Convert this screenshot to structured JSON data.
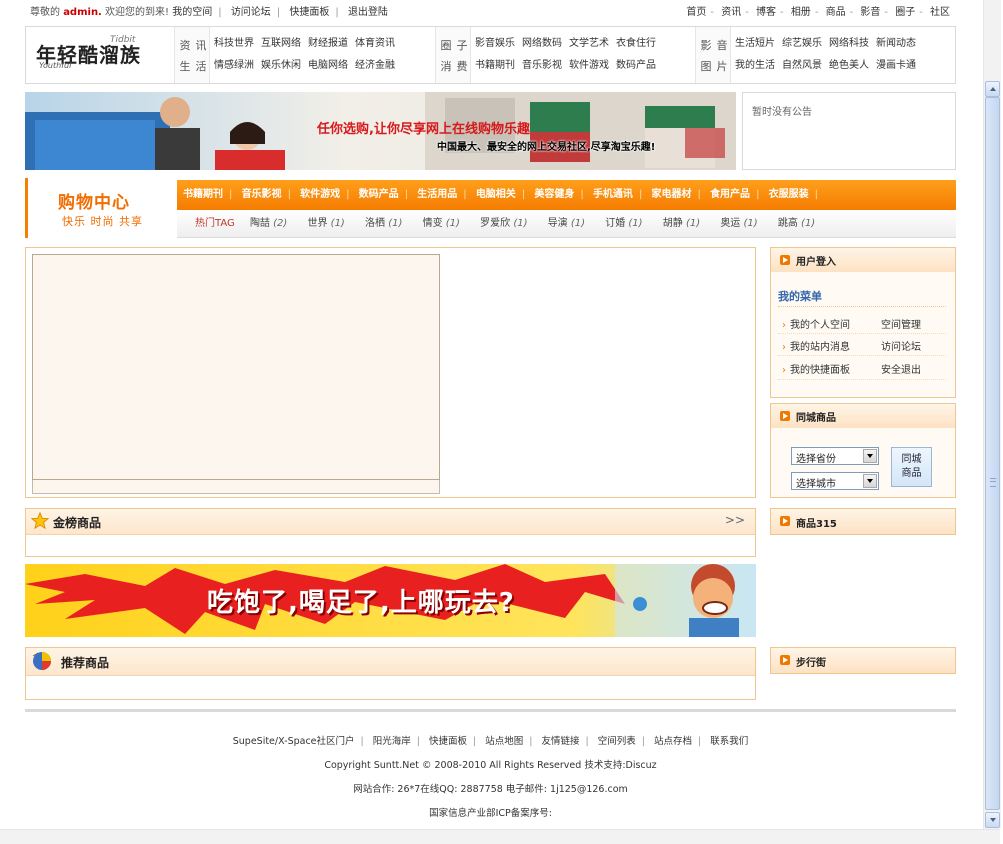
{
  "topbar": {
    "welcome_prefix": "尊敬的",
    "username": "admin.",
    "welcome_suffix": "欢迎您的到来!",
    "links": [
      "我的空间",
      "访问论坛",
      "快捷面板",
      "退出登陆"
    ],
    "right_links": [
      "首页",
      "资讯",
      "博客",
      "相册",
      "商品",
      "影音",
      "圈子",
      "社区"
    ]
  },
  "logo": {
    "cn": "年轻酷溜族",
    "en1": "Youthful",
    "en2": "Tidbit"
  },
  "nav": [
    {
      "cat": [
        "资",
        "讯",
        "生",
        "活"
      ],
      "rows": [
        [
          "科技世界",
          "互联网络",
          "财经报道",
          "体育资讯"
        ],
        [
          "情感绿洲",
          "娱乐休闲",
          "电脑网络",
          "经济金融"
        ]
      ]
    },
    {
      "cat": [
        "圈",
        "子",
        "消",
        "费"
      ],
      "rows": [
        [
          "影音娱乐",
          "网络数码",
          "文学艺术",
          "衣食住行"
        ],
        [
          "书籍期刊",
          "音乐影视",
          "软件游戏",
          "数码产品"
        ]
      ]
    },
    {
      "cat": [
        "影",
        "音",
        "图",
        "片"
      ],
      "rows": [
        [
          "生活短片",
          "综艺娱乐",
          "网络科技",
          "新闻动态"
        ],
        [
          "我的生活",
          "自然风景",
          "绝色美人",
          "漫画卡通"
        ]
      ]
    }
  ],
  "banner": {
    "headline": "任你选购,让你尽享网上在线购物乐趣",
    "subline": "中国最大、最安全的网上交易社区,尽享淘宝乐趣!"
  },
  "notice": {
    "text": "暂时没有公告"
  },
  "shop": {
    "title": "购物中心",
    "slogan": "快乐 时尚 共享",
    "categories": [
      "书籍期刊",
      "音乐影视",
      "软件游戏",
      "数码产品",
      "生活用品",
      "电脑相关",
      "美容健身",
      "手机通讯",
      "家电器材",
      "食用产品",
      "衣服服装"
    ],
    "hot_label": "热门TAG",
    "tags": [
      {
        "name": "陶喆",
        "count": "(2)"
      },
      {
        "name": "世界",
        "count": "(1)"
      },
      {
        "name": "洛栖",
        "count": "(1)"
      },
      {
        "name": "情变",
        "count": "(1)"
      },
      {
        "name": "罗爱欣",
        "count": "(1)"
      },
      {
        "name": "导演",
        "count": "(1)"
      },
      {
        "name": "订婚",
        "count": "(1)"
      },
      {
        "name": "胡静",
        "count": "(1)"
      },
      {
        "name": "奥运",
        "count": "(1)"
      },
      {
        "name": "跳高",
        "count": "(1)"
      }
    ]
  },
  "panels": {
    "top_goods": {
      "title": "金榜商品",
      "more": ">>"
    },
    "recommend": {
      "title": "推荐商品"
    }
  },
  "ad": {
    "text": "吃饱了,喝足了,上哪玩去?"
  },
  "sidebar": {
    "login": {
      "title": "用户登入",
      "menu_title": "我的菜单",
      "items": [
        "我的个人空间",
        "空间管理",
        "我的站内消息",
        "访问论坛",
        "我的快捷面板",
        "安全退出"
      ]
    },
    "city": {
      "title": "同城商品",
      "province": "选择省份",
      "city": "选择城市",
      "button": "同城商品"
    },
    "goods315": {
      "title": "商品315"
    },
    "street": {
      "title": "步行街"
    }
  },
  "footer": {
    "links": [
      "SupeSite/X-Space社区门户",
      "阳光海岸",
      "快捷面板",
      "站点地图",
      "友情链接",
      "空间列表",
      "站点存档",
      "联系我们"
    ],
    "copyright": "Copyright Suntt.Net © 2008-2010 All Rights Reserved 技术支持:Discuz",
    "contact": "网站合作: 26*7在线QQ: 2887758  电子邮件: 1j125@126.com",
    "icp": "国家信息产业部ICP备案序号:"
  },
  "colors": {
    "accent": "#f57c00",
    "border": "#f0c690",
    "admin": "#cc0000"
  }
}
